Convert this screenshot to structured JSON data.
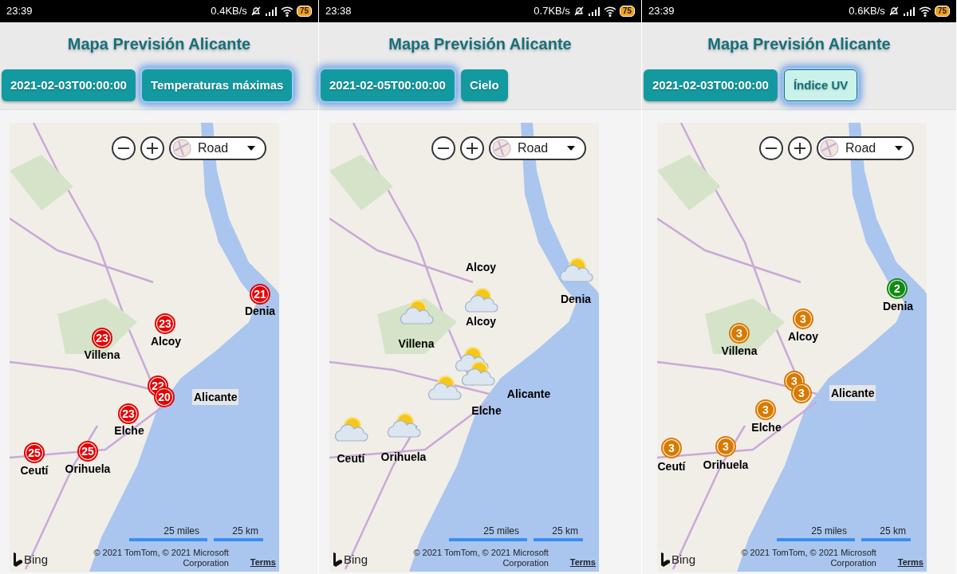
{
  "panels": [
    {
      "status": {
        "time": "23:39",
        "speed": "0.4KB/s",
        "battery": "75"
      },
      "title": "Mapa Previsión Alicante",
      "buttons": [
        {
          "label": "2021-02-03T00:00:00",
          "selected": false,
          "pressed": false
        },
        {
          "label": "Temperaturas máximas",
          "selected": true,
          "pressed": false
        }
      ],
      "map": {
        "style": "Road",
        "scale_miles": "25 miles",
        "scale_km": "25 km",
        "brand": "Bing",
        "copyright": "© 2021 TomTom, © 2021 Microsoft Corporation",
        "terms": "Terms"
      },
      "markers": [
        {
          "kind": "value",
          "value": "21",
          "color": "#e60000",
          "title": "Denia"
        },
        {
          "kind": "value",
          "value": "23",
          "color": "#e60000",
          "title": "Alcoy"
        },
        {
          "kind": "value",
          "value": "23",
          "color": "#e60000",
          "title": "Villena"
        },
        {
          "kind": "value",
          "value": "22",
          "color": "#e60000"
        },
        {
          "kind": "value",
          "value": "20",
          "color": "#e60000",
          "title": "Alicante"
        },
        {
          "kind": "value",
          "value": "23",
          "color": "#e60000",
          "title": "Elche"
        },
        {
          "kind": "value",
          "value": "25",
          "color": "#e60000",
          "title": "Ceutí"
        },
        {
          "kind": "value",
          "value": "25",
          "color": "#e60000",
          "title": "Orihuela"
        }
      ]
    },
    {
      "status": {
        "time": "23:38",
        "speed": "0.7KB/s",
        "battery": "75"
      },
      "title": "Mapa Previsión Alicante",
      "buttons": [
        {
          "label": "2021-02-05T00:00:00",
          "selected": true,
          "pressed": false
        },
        {
          "label": "Cielo",
          "selected": false,
          "pressed": false
        }
      ],
      "map": {
        "style": "Road",
        "scale_miles": "25 miles",
        "scale_km": "25 km",
        "brand": "Bing",
        "copyright": "© 2021 TomTom, © 2021 Microsoft Corporation",
        "terms": "Terms"
      },
      "markers": [
        {
          "kind": "weather",
          "title": "Denia"
        },
        {
          "kind": "weather",
          "title": "Alcoy"
        },
        {
          "kind": "weather",
          "title": "Villena"
        },
        {
          "kind": "weather"
        },
        {
          "kind": "weather",
          "title": "Alicante"
        },
        {
          "kind": "weather",
          "title": "Elche"
        },
        {
          "kind": "weather",
          "title": "Ceutí"
        },
        {
          "kind": "weather",
          "title": "Orihuela"
        },
        {
          "kind": "label",
          "title": "Alcoy"
        }
      ]
    },
    {
      "status": {
        "time": "23:39",
        "speed": "0.6KB/s",
        "battery": "75"
      },
      "title": "Mapa Previsión Alicante",
      "buttons": [
        {
          "label": "2021-02-03T00:00:00",
          "selected": false,
          "pressed": false
        },
        {
          "label": "Índice UV",
          "selected": true,
          "pressed": true
        }
      ],
      "map": {
        "style": "Road",
        "scale_miles": "25 miles",
        "scale_km": "25 km",
        "brand": "Bing",
        "copyright": "© 2021 TomTom, © 2021 Microsoft Corporation",
        "terms": "Terms"
      },
      "markers": [
        {
          "kind": "value",
          "value": "2",
          "color": "#128a12",
          "title": "Denia"
        },
        {
          "kind": "value",
          "value": "3",
          "color": "#d97a00",
          "title": "Alcoy"
        },
        {
          "kind": "value",
          "value": "3",
          "color": "#d97a00",
          "title": "Villena"
        },
        {
          "kind": "value",
          "value": "3",
          "color": "#d97a00"
        },
        {
          "kind": "value",
          "value": "3",
          "color": "#d97a00",
          "title": "Alicante"
        },
        {
          "kind": "value",
          "value": "3",
          "color": "#d97a00",
          "title": "Elche"
        },
        {
          "kind": "value",
          "value": "3",
          "color": "#d97a00",
          "title": "Ceutí"
        },
        {
          "kind": "value",
          "value": "3",
          "color": "#d97a00",
          "title": "Orihuela"
        }
      ]
    }
  ]
}
